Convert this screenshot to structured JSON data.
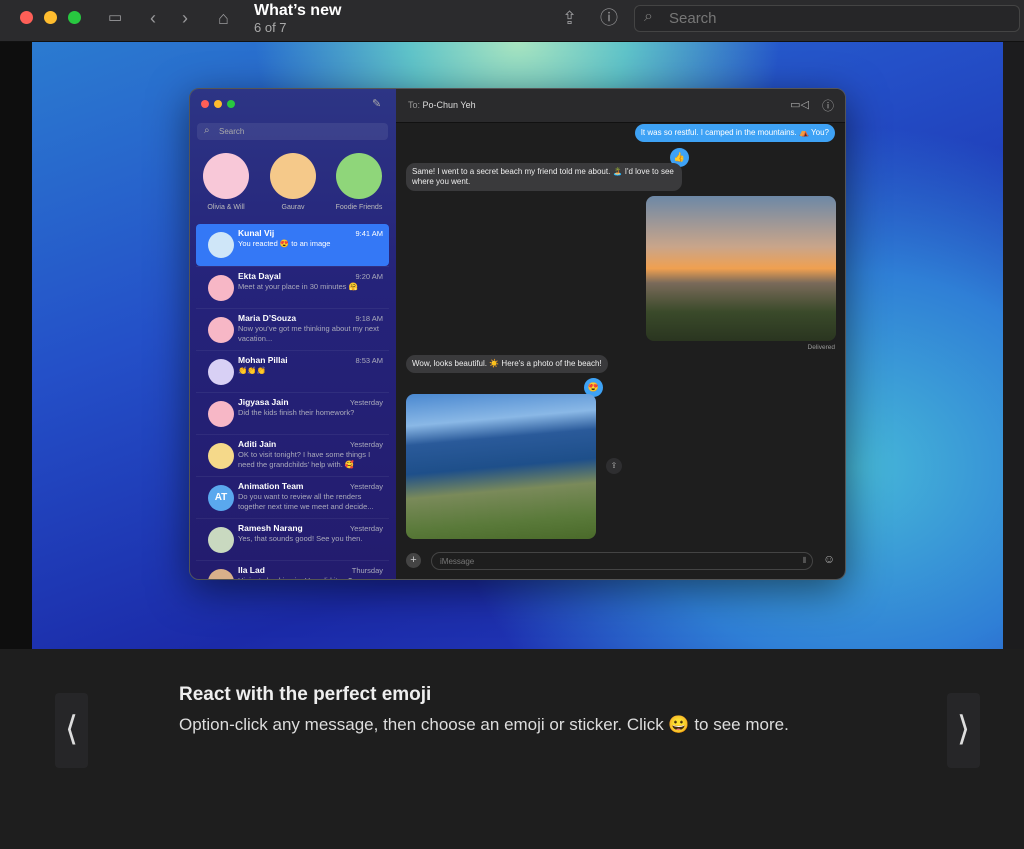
{
  "toolbar": {
    "title": "What’s new",
    "subtitle": "6 of 7",
    "search_placeholder": "Search"
  },
  "messages": {
    "search_placeholder": "Search",
    "pinned": [
      {
        "name": "Olivia & Will",
        "color": "#f8c8d8"
      },
      {
        "name": "Gaurav",
        "color": "#f5c98a"
      },
      {
        "name": "Foodie Friends",
        "color": "#8fd67a"
      }
    ],
    "conversations": [
      {
        "name": "Kunal Vij",
        "time": "9:41 AM",
        "preview": "You reacted 😍 to an image",
        "selected": true,
        "color": "#cfe6f8"
      },
      {
        "name": "Ekta Dayal",
        "time": "9:20 AM",
        "preview": "Meet at your place in 30 minutes 🤗",
        "color": "#f7b7c6"
      },
      {
        "name": "Maria D’Souza",
        "time": "9:18 AM",
        "preview": "Now you’ve got me thinking about my next vacation...",
        "color": "#f7b7c6"
      },
      {
        "name": "Mohan Pillai",
        "time": "8:53 AM",
        "preview": "👏👏👏",
        "color": "#d8d0f5"
      },
      {
        "name": "Jigyasa Jain",
        "time": "Yesterday",
        "preview": "Did the kids finish their homework?",
        "color": "#f7b7c6"
      },
      {
        "name": "Aditi Jain",
        "time": "Yesterday",
        "preview": "OK to visit tonight? I have some things I need the grandchilds’ help with. 🥰",
        "color": "#f5d98a"
      },
      {
        "name": "Animation Team",
        "time": "Yesterday",
        "preview": "Do you want to review all the renders together next time we meet and decide...",
        "initials": "AT",
        "color": "#5aa8ee"
      },
      {
        "name": "Ramesh Narang",
        "time": "Yesterday",
        "preview": "Yes, that sounds good! See you then.",
        "color": "#c9d9c0"
      },
      {
        "name": "Ila Lad",
        "time": "Thursday",
        "preview": "Hi, just checking in. How did it go?",
        "color": "#d9b08a"
      }
    ],
    "to_label": "To:",
    "recipient": "Po-Chun Yeh",
    "thread": [
      {
        "text": "It was so restful. I camped in the mountains. ⛺ You?",
        "dir": "out"
      },
      {
        "text": "Same! I went to a secret beach my friend told me about. 🏝️ I'd love to see where you went.",
        "dir": "in",
        "tapback": "👍"
      },
      {
        "status": "Delivered"
      },
      {
        "text": "Wow, looks beautiful. ☀️ Here's a photo of the beach!",
        "dir": "in",
        "tapback": "😍"
      }
    ],
    "input_placeholder": "iMessage"
  },
  "tip": {
    "heading": "React with the perfect emoji",
    "body": "Option-click any message, then choose an emoji or sticker.  Click 😀 to see more.",
    "prev": "⟨",
    "next": "⟩"
  }
}
